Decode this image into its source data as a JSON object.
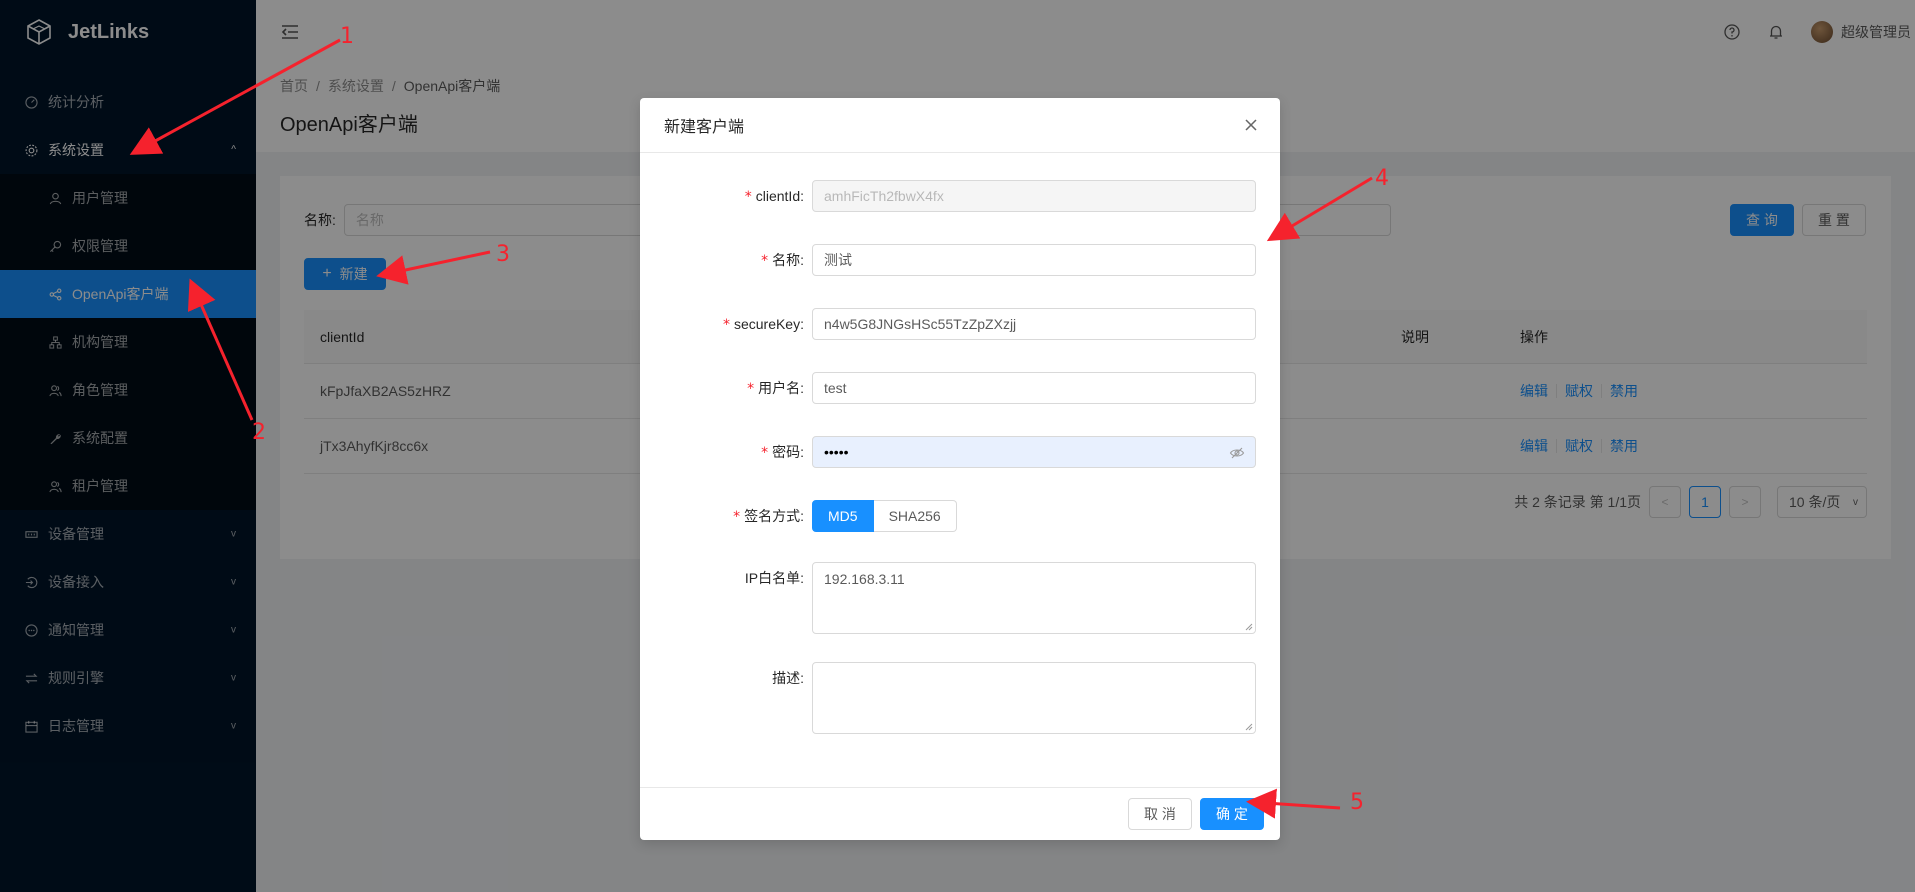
{
  "app": {
    "name": "JetLinks"
  },
  "sidebar": {
    "items": [
      {
        "label": "统计分析",
        "icon": "dashboard-icon"
      },
      {
        "label": "系统设置",
        "icon": "setting-icon",
        "expanded": true,
        "children": [
          {
            "label": "用户管理",
            "icon": "user-icon"
          },
          {
            "label": "权限管理",
            "icon": "key-icon"
          },
          {
            "label": "OpenApi客户端",
            "icon": "share-icon",
            "active": true
          },
          {
            "label": "机构管理",
            "icon": "apartment-icon"
          },
          {
            "label": "角色管理",
            "icon": "usergroup-icon"
          },
          {
            "label": "系统配置",
            "icon": "tool-icon"
          },
          {
            "label": "租户管理",
            "icon": "team-icon"
          }
        ]
      },
      {
        "label": "设备管理",
        "icon": "device-icon"
      },
      {
        "label": "设备接入",
        "icon": "login-icon"
      },
      {
        "label": "通知管理",
        "icon": "message-icon"
      },
      {
        "label": "规则引擎",
        "icon": "swap-icon"
      },
      {
        "label": "日志管理",
        "icon": "calendar-icon"
      }
    ]
  },
  "header": {
    "username": "超级管理员"
  },
  "breadcrumb": [
    "首页",
    "系统设置",
    "OpenApi客户端"
  ],
  "page": {
    "title": "OpenApi客户端"
  },
  "search": {
    "label": "名称:",
    "placeholder": "名称",
    "query_label": "查 询",
    "reset_label": "重 置"
  },
  "toolbar": {
    "new_label": "新建"
  },
  "table": {
    "columns": {
      "clientId": "clientId",
      "desc": "说明",
      "op": "操作"
    },
    "rows": [
      {
        "clientId": "kFpJfaXB2AS5zHRZ"
      },
      {
        "clientId": "jTx3AhyfKjr8cc6x"
      }
    ],
    "actions": [
      "编辑",
      "赋权",
      "禁用"
    ]
  },
  "pagination": {
    "total_text": "共 2 条记录 第 1/1页",
    "current": "1",
    "page_size": "10 条/页"
  },
  "modal": {
    "title": "新建客户端",
    "fields": {
      "clientId": {
        "label": "clientId:",
        "value": "amhFicTh2fbwX4fx"
      },
      "name": {
        "label": "名称:",
        "value": "测试"
      },
      "secureKey": {
        "label": "secureKey:",
        "value": "n4w5G8JNGsHSc55TzZpZXzjj"
      },
      "username": {
        "label": "用户名:",
        "value": "test"
      },
      "password": {
        "label": "密码:",
        "value": "•••••"
      },
      "sign": {
        "label": "签名方式:",
        "options": [
          "MD5",
          "SHA256"
        ],
        "selected": "MD5"
      },
      "ipWhitelist": {
        "label": "IP白名单:",
        "value": "192.168.3.11"
      },
      "description": {
        "label": "描述:",
        "value": ""
      }
    },
    "cancel_label": "取 消",
    "ok_label": "确 定"
  },
  "annotations": [
    "1",
    "2",
    "3",
    "4",
    "5"
  ],
  "colors": {
    "primary": "#1890ff",
    "sider": "#001529",
    "annotation": "#f5222d"
  }
}
